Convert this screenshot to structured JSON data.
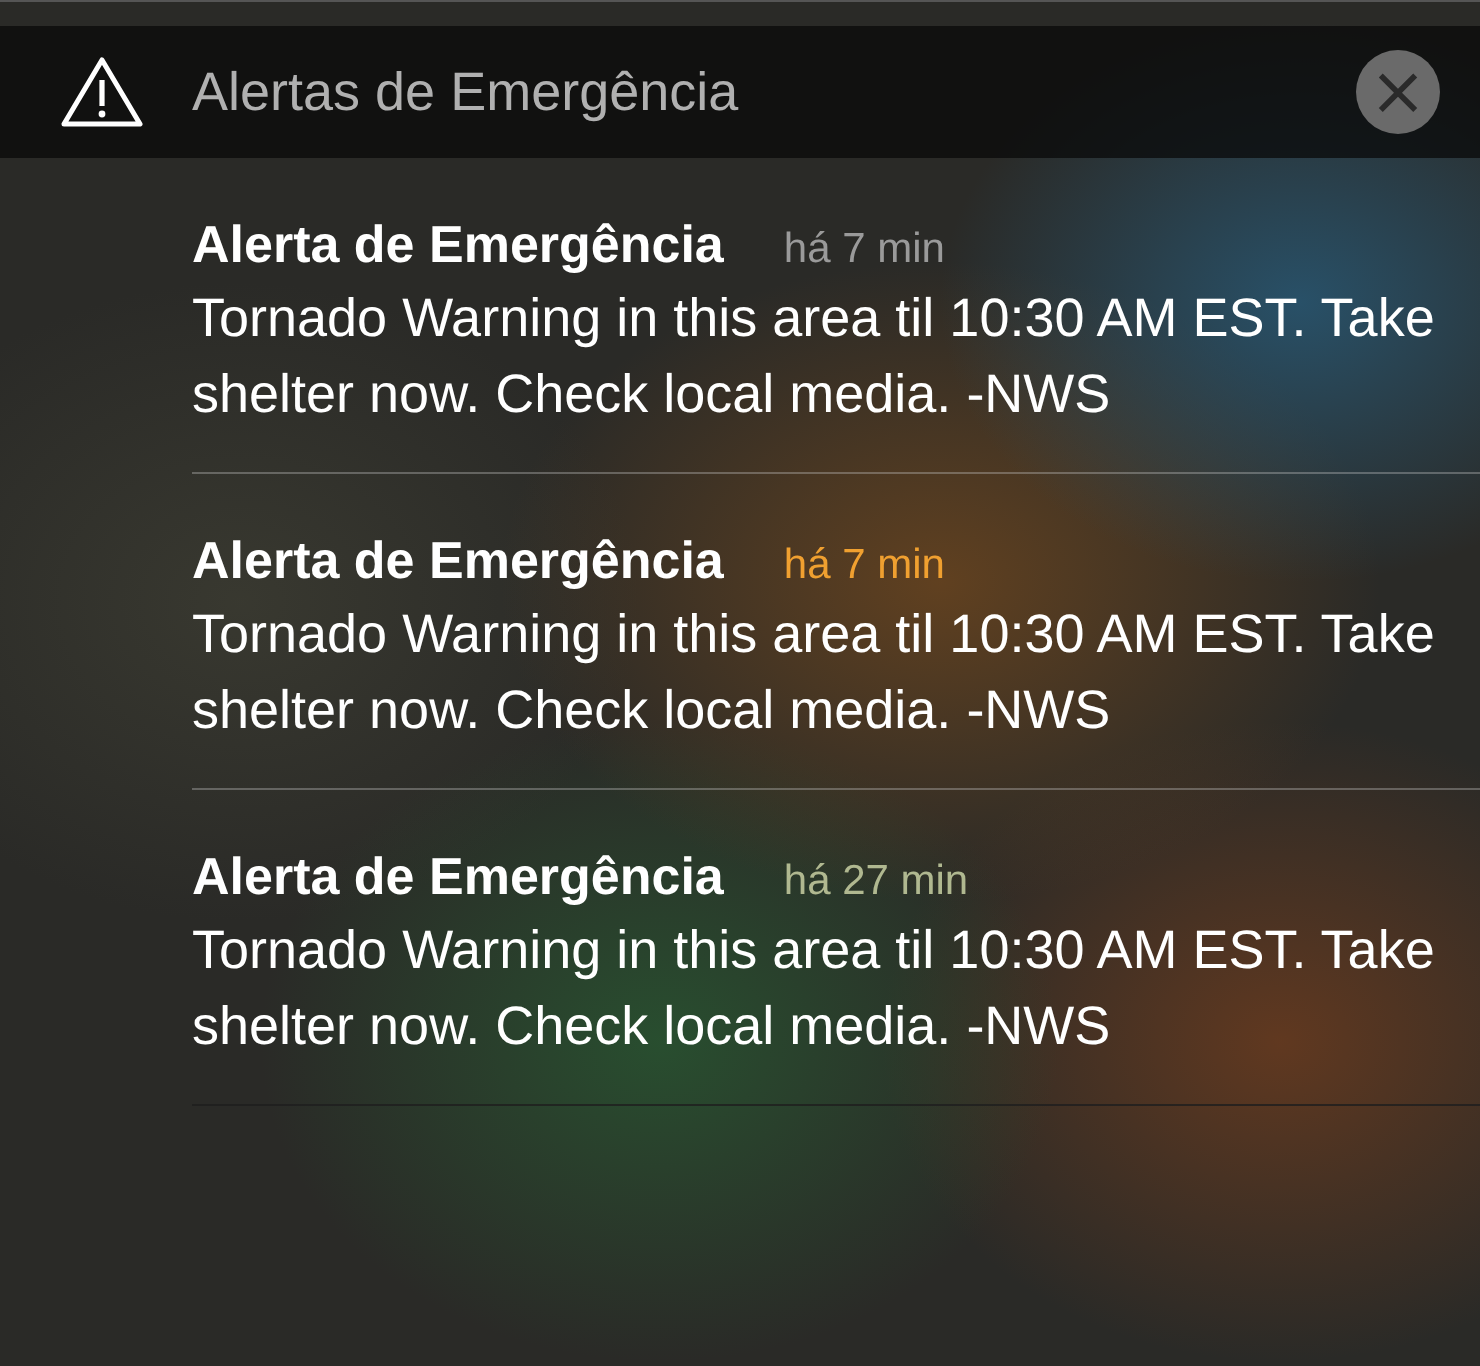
{
  "header": {
    "title": "Alertas de Emergência",
    "close_label": "×"
  },
  "notifications": [
    {
      "title": "Alerta de Emergência",
      "time": "há 7 min",
      "color": "#9a9a9a",
      "body": "Tornado Warning in this area til 10:30 AM EST. Take shelter now. Check local media. -NWS"
    },
    {
      "title": "Alerta de Emergência",
      "time": "há 7 min",
      "color": "#f0a030",
      "body": "Tornado Warning in this area til 10:30 AM EST. Take shelter now. Check local media. -NWS"
    },
    {
      "title": "Alerta de Emergência",
      "time": "há 27 min",
      "color": "#b0b890",
      "body": "Tornado Warning in this area til 10:30 AM EST. Take shelter now. Check local media. -NWS"
    }
  ]
}
